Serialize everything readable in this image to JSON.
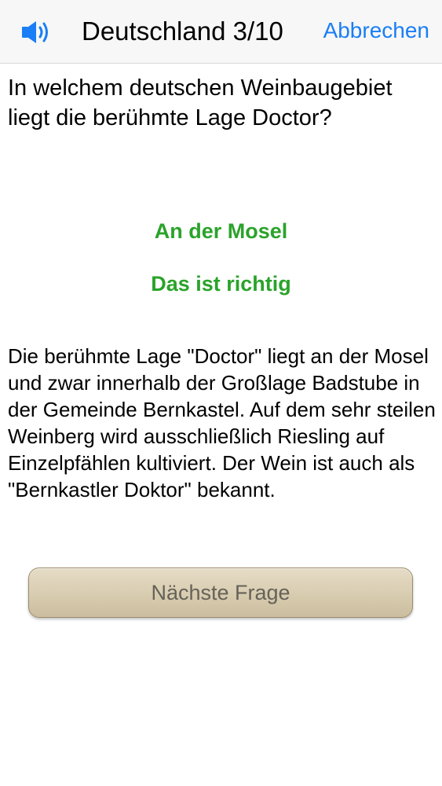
{
  "navbar": {
    "sound_icon": "speaker-volume-icon",
    "title": "Deutschland 3/10",
    "cancel_label": "Abbrechen",
    "accent_color": "#1a7ef6"
  },
  "question": {
    "text": "In welchem deutschen Weinbaugebiet liegt die berühmte Lage Doctor?"
  },
  "result": {
    "answer": "An der Mosel",
    "verdict": "Das ist richtig",
    "color": "#2aa32a"
  },
  "explanation": {
    "text": "Die berühmte Lage \"Doctor\" liegt an der Mosel und zwar innerhalb der Großlage Badstube in der Gemeinde Bernkastel. Auf dem sehr steilen Weinberg wird ausschließlich Riesling auf Einzelpfählen kultiviert. Der Wein ist auch als \"Bernkastler Doktor\" bekannt."
  },
  "next_button": {
    "label": "Nächste Frage"
  }
}
